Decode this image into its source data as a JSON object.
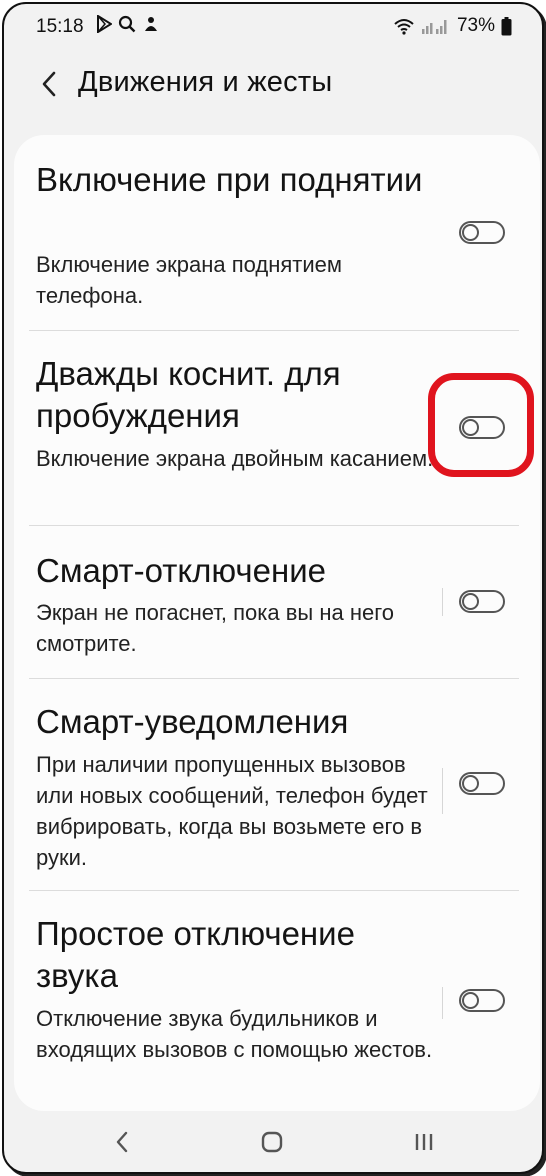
{
  "status_bar": {
    "time": "15:18",
    "battery_percent": "73%",
    "icons": [
      "play-store-icon",
      "search-icon",
      "notification-icon",
      "wifi-icon",
      "signal-icon",
      "battery-icon"
    ]
  },
  "header": {
    "title": "Движения и жесты",
    "back_icon": "chevron-left-icon"
  },
  "settings": [
    {
      "title": "Включение при поднятии",
      "description": "Включение экрана поднятием телефона.",
      "enabled": false
    },
    {
      "title": "Дважды коснит. для пробуждения",
      "description": "Включение экрана двойным касанием.",
      "enabled": false,
      "highlighted": true
    },
    {
      "title": "Смарт-отключение",
      "description": "Экран не погаснет, пока вы на него смотрите.",
      "enabled": false
    },
    {
      "title": "Смарт-уведомления",
      "description": "При наличии пропущенных вызовов или новых сообщений, телефон будет вибрировать, когда вы возьмете его в руки.",
      "enabled": false
    },
    {
      "title": "Простое отключение звука",
      "description": "Отключение звука будильников и входящих вызовов с помощью жестов.",
      "enabled": false
    }
  ],
  "nav_bar": {
    "buttons": [
      "back-icon",
      "home-icon",
      "recents-icon"
    ]
  },
  "colors": {
    "highlight": "#e0141e",
    "background": "#f2f2f2",
    "card": "#fcfcfc"
  }
}
